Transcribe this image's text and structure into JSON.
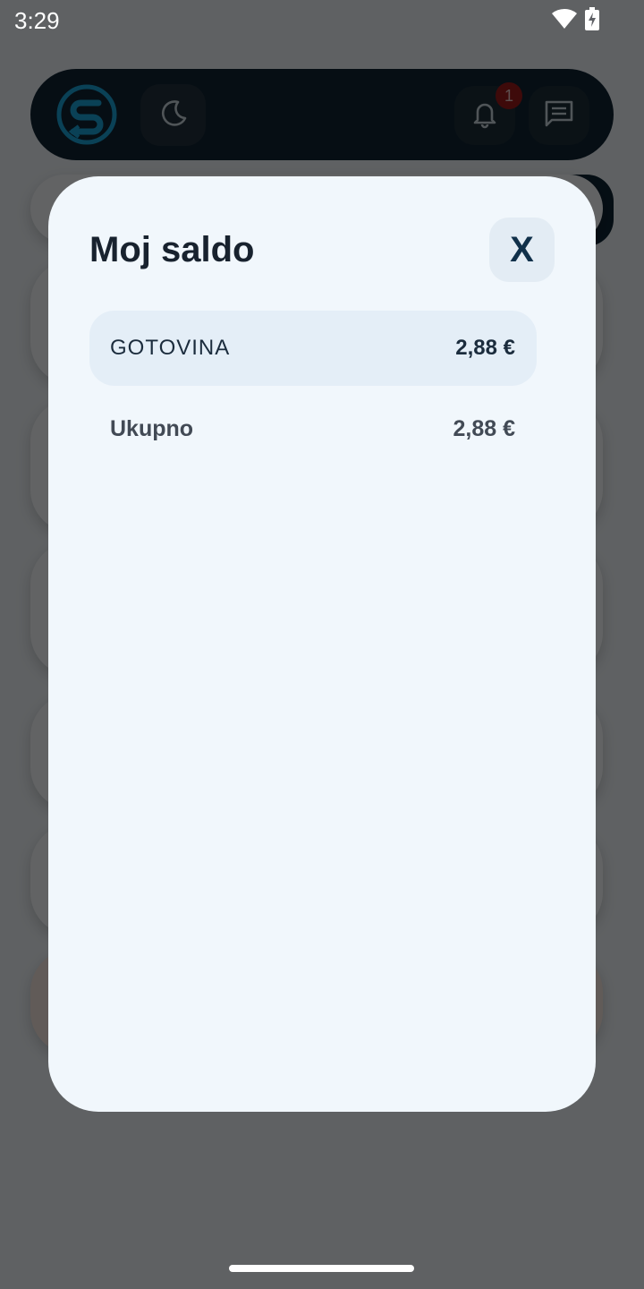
{
  "status_bar": {
    "time": "3:29",
    "icons": [
      "wifi-icon",
      "battery-charging-icon"
    ]
  },
  "background_app": {
    "logo": "app-logo-s",
    "theme_toggle_icon": "moon-icon",
    "notifications_icon": "bell-icon",
    "notifications_badge": "1",
    "messages_icon": "chat-icon"
  },
  "dialog": {
    "title": "Moj saldo",
    "close_label": "X",
    "balances": [
      {
        "label": "GOTOVINA",
        "amount": "2,88 €"
      }
    ],
    "total": {
      "label": "Ukupno",
      "amount": "2,88 €"
    }
  },
  "colors": {
    "dialog_background": "#f1f7fc",
    "row_highlight": "#e4eef7",
    "title_text": "#18222e",
    "close_button_bg": "#e3ecf4",
    "top_bar_bg": "#0f2434",
    "badge_bg": "#9b1b1b"
  }
}
